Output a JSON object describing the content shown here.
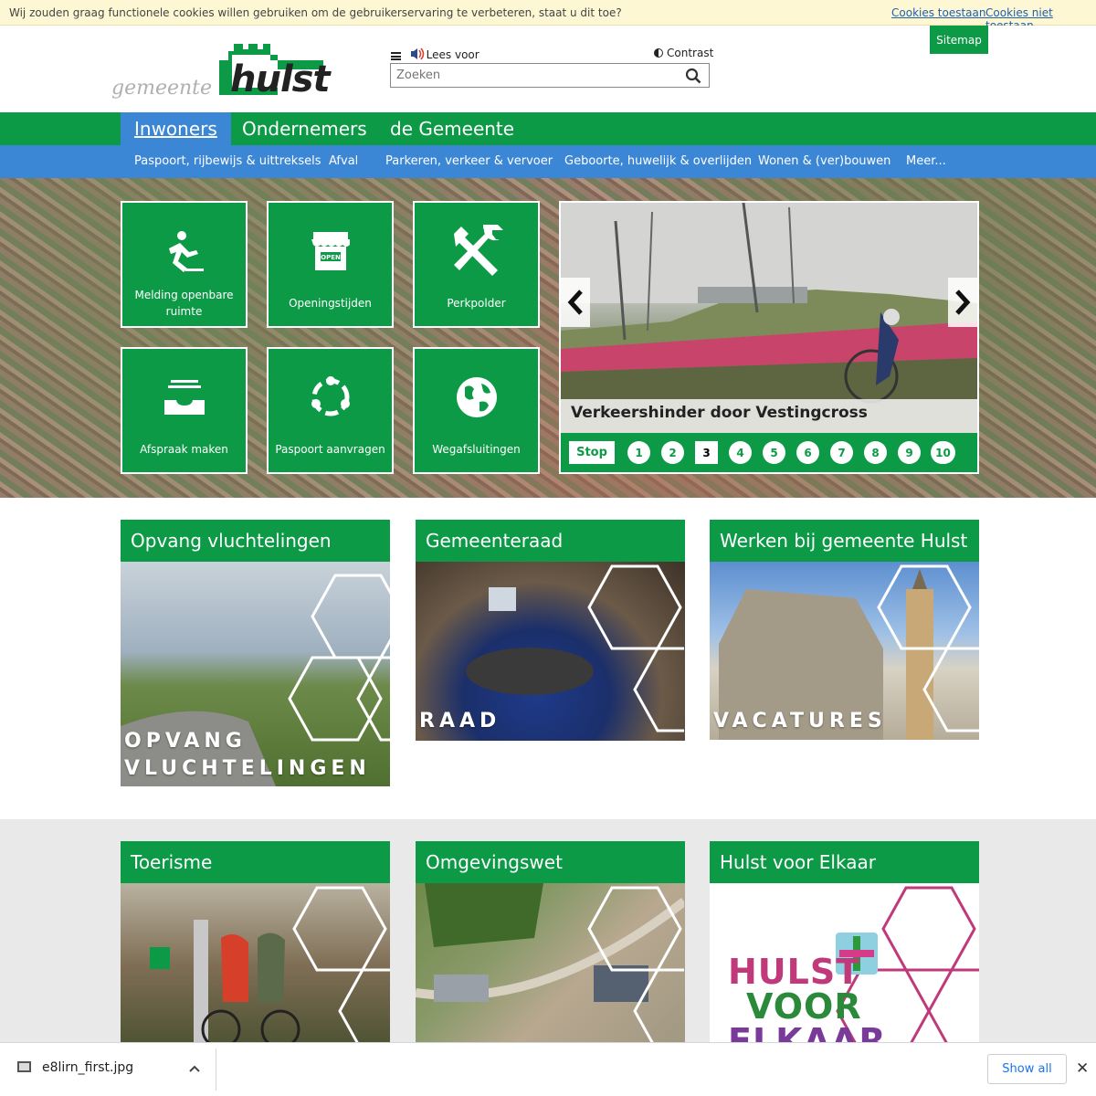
{
  "cookie": {
    "message": "Wij zouden graag functionele cookies willen gebruiken om de gebruikerservaring te verbeteren, staat u dit toe?",
    "allow": "Cookies toestaan",
    "deny": "Cookies niet toestaan"
  },
  "header": {
    "logo_gemeente": "gemeente",
    "logo_hulst": "hulst",
    "read_aloud": "Lees voor",
    "contrast": "Contrast",
    "search_placeholder": "Zoeken",
    "sitemap": "Sitemap"
  },
  "main_nav": [
    "Inwoners",
    "Ondernemers",
    "de Gemeente"
  ],
  "sub_nav": [
    "Paspoort, rijbewijs & uittreksels",
    "Afval",
    "Parkeren, verkeer & vervoer",
    "Geboorte, huwelijk & overlijden",
    "Wonen & (ver)bouwen",
    "Meer..."
  ],
  "tiles": [
    {
      "label": "Melding openbare ruimte",
      "icon": "slip-icon"
    },
    {
      "label": "Openingstijden",
      "icon": "open-shop-icon"
    },
    {
      "label": "Perkpolder",
      "icon": "tools-icon"
    },
    {
      "label": "Afspraak maken",
      "icon": "inbox-icon"
    },
    {
      "label": "Paspoort aanvragen",
      "icon": "circle-arrows-icon"
    },
    {
      "label": "Wegafsluitingen",
      "icon": "globe-icon"
    }
  ],
  "slider": {
    "caption": "Verkeershinder door Vestingcross",
    "stop": "Stop",
    "pages": [
      "1",
      "2",
      "3",
      "4",
      "5",
      "6",
      "7",
      "8",
      "9",
      "10"
    ],
    "current": "3"
  },
  "cards": [
    {
      "title": "Opvang vluchtelingen",
      "overlay_line1": "OPVANG",
      "overlay_line2": "VLUCHTELINGEN"
    },
    {
      "title": "Gemeenteraad",
      "overlay_line1": "RAAD"
    },
    {
      "title": "Werken bij gemeente Hulst",
      "overlay_line1": "VACATURES"
    },
    {
      "title": "Toerisme"
    },
    {
      "title": "Omgevingswet"
    },
    {
      "title": "Hulst voor Elkaar",
      "logo_l1": "HULST",
      "logo_l2": "VOOR",
      "logo_l3": "ELKAAR"
    }
  ],
  "download_bar": {
    "filename": "e8lirn_first.jpg",
    "show_all": "Show all"
  },
  "colors": {
    "green": "#0d9a46",
    "blue": "#3b87d6",
    "cookie_bg": "#fdf7d4"
  }
}
